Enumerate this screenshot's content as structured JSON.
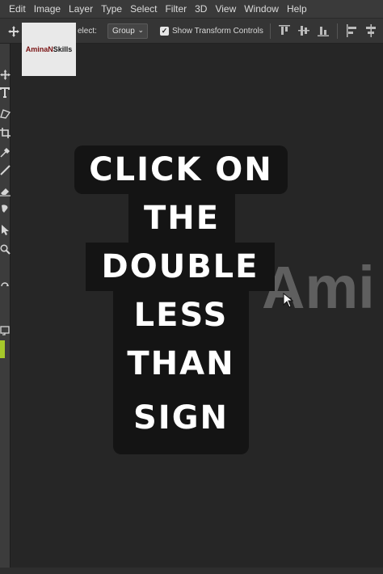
{
  "menu": {
    "items": [
      "Edit",
      "Image",
      "Layer",
      "Type",
      "Select",
      "Filter",
      "3D",
      "View",
      "Window",
      "Help"
    ]
  },
  "options": {
    "select_label": "elect:",
    "group_value": "Group",
    "show_transform_label": "Show Transform Controls",
    "show_transform_checked": true
  },
  "logo": {
    "part1": "AminaN",
    "part2": "Skills",
    "colors": {
      "part1": "#7a1414",
      "part2": "#1a1a1a"
    }
  },
  "canvas": {
    "background_text": "Ami"
  },
  "caption": {
    "lines": [
      "CLICK ON",
      "THE",
      "DOUBLE",
      "LESS",
      "THAN",
      "SIGN"
    ]
  },
  "colors": {
    "workspace": "#262626",
    "menubar": "#3a3a3a",
    "caption_bg": "#141414",
    "foreground_swatch": "#a6c92a"
  },
  "icons": {
    "options_move": "move-tool-icon",
    "toolbar": [
      "move-tool-icon",
      "type-tool-icon",
      "lasso-tool-icon",
      "crop-tool-icon",
      "eyedropper-tool-icon",
      "brush-tool-icon",
      "eraser-tool-icon",
      "smudge-tool-icon",
      "path-selection-tool-icon",
      "zoom-tool-icon",
      "rotate-view-icon",
      "screen-mode-icon"
    ]
  }
}
